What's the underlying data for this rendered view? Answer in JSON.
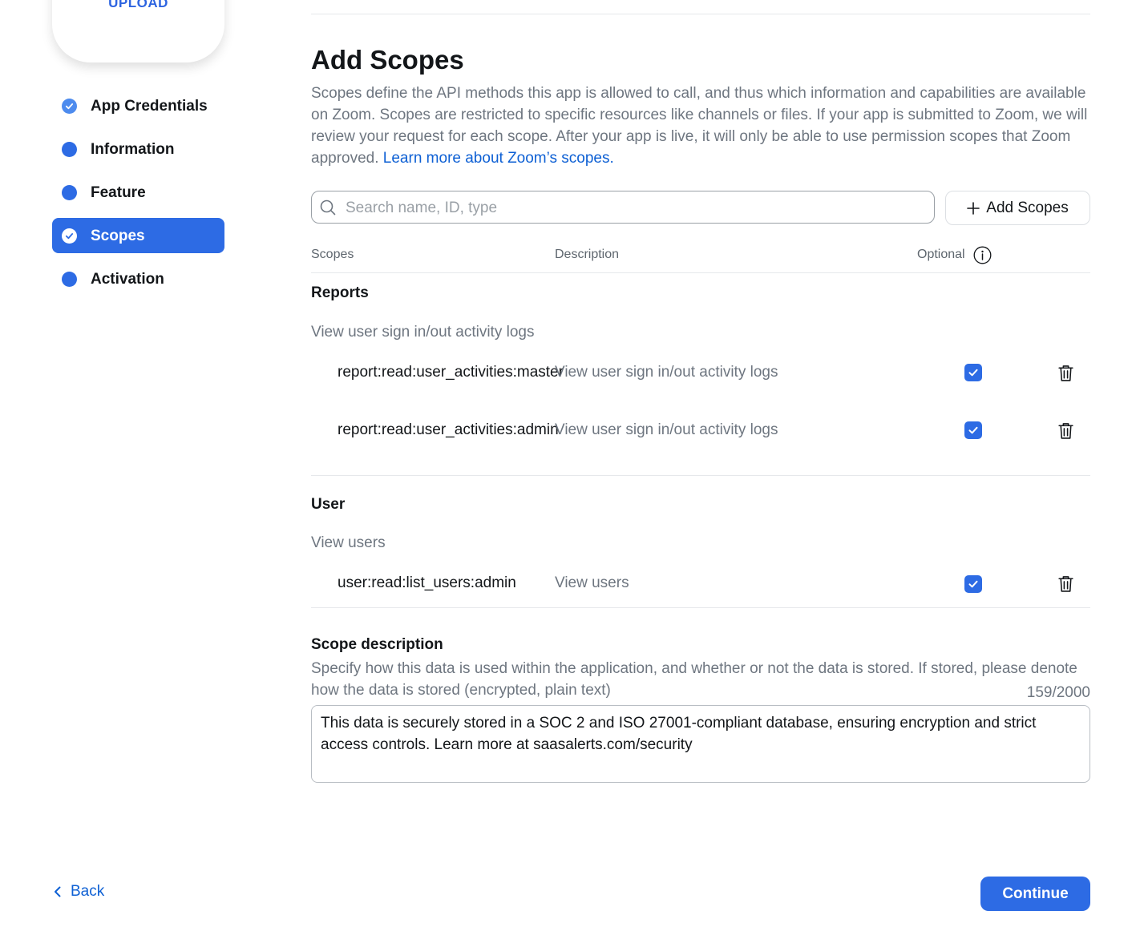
{
  "upload_card": {
    "label": "UPLOAD"
  },
  "sidebar": {
    "items": [
      {
        "label": "App Credentials",
        "state": "done"
      },
      {
        "label": "Information",
        "state": "pending"
      },
      {
        "label": "Feature",
        "state": "pending"
      },
      {
        "label": "Scopes",
        "state": "active"
      },
      {
        "label": "Activation",
        "state": "pending"
      }
    ]
  },
  "main": {
    "title": "Add Scopes",
    "intro": "Scopes define the API methods this app is allowed to call, and thus which information and capabilities are available on Zoom. Scopes are restricted to specific resources like channels or files. If your app is submitted to Zoom, we will review your request for each scope. After your app is live, it will only be able to use permission scopes that Zoom approved.",
    "intro_link": "Learn more about Zoom’s scopes.",
    "search": {
      "placeholder": "Search name, ID, type",
      "value": ""
    },
    "add_button": "Add Scopes",
    "table": {
      "headers": {
        "scopes": "Scopes",
        "description": "Description",
        "optional": "Optional"
      },
      "groups": [
        {
          "title": "Reports",
          "subtitle": "View user sign in/out activity logs",
          "rows": [
            {
              "name": "report:read:user_activities:master",
              "description": "View user sign in/out activity logs",
              "optional": true
            },
            {
              "name": "report:read:user_activities:admin",
              "description": "View user sign in/out activity logs",
              "optional": true
            }
          ]
        },
        {
          "title": "User",
          "subtitle": "View users",
          "rows": [
            {
              "name": "user:read:list_users:admin",
              "description": "View users",
              "optional": true
            }
          ]
        }
      ]
    },
    "scope_description": {
      "title": "Scope description",
      "help": "Specify how this data is used within the application, and whether or not the data is stored. If stored, please denote how the data is stored (encrypted, plain text)",
      "counter": "159/2000",
      "value": "This data is securely stored in a SOC 2 and ISO 27001-compliant database, ensuring encryption and strict access controls. Learn more at saasalerts.com/security"
    }
  },
  "footer": {
    "back_label": "Back",
    "continue_label": "Continue"
  },
  "colors": {
    "accent": "#2d6be4",
    "link": "#0e60d4",
    "muted_text": "#6e7680",
    "divider": "#e6e8eb"
  },
  "icons": {
    "search": "search-icon",
    "add": "plus-icon",
    "info": "info-icon",
    "trash": "trash-icon",
    "check": "checkmark-icon",
    "back": "chevron-left-icon"
  }
}
